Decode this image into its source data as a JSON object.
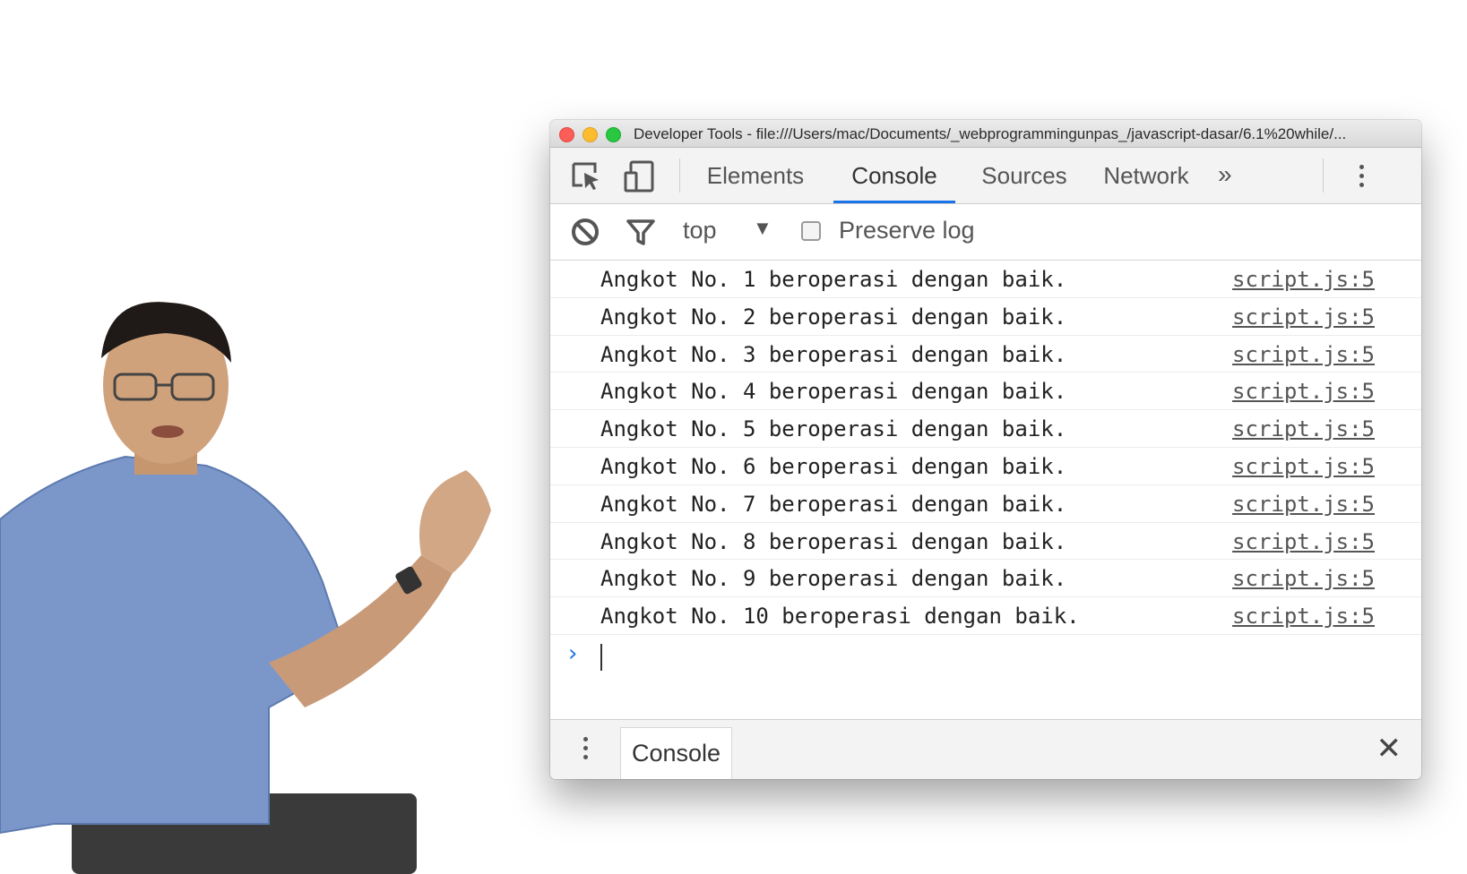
{
  "window": {
    "title": "Developer Tools - file:///Users/mac/Documents/_webprogrammingunpas_/javascript-dasar/6.1%20while/..."
  },
  "tabs": [
    {
      "label": "Elements"
    },
    {
      "label": "Console",
      "active": true
    },
    {
      "label": "Sources"
    },
    {
      "label": "Network"
    }
  ],
  "toolbar": {
    "more_tabs_label": "»",
    "inspect_icon": "inspect-element-icon",
    "device_icon": "device-toolbar-icon"
  },
  "filter": {
    "clear_icon": "clear-console-icon",
    "filter_icon": "filter-icon",
    "context": "top",
    "context_arrow": "▼",
    "preserve_log_label": "Preserve log",
    "preserve_log_checked": false
  },
  "console": {
    "messages": [
      {
        "text": "Angkot No. 1 beroperasi dengan baik.",
        "source": "script.js:5"
      },
      {
        "text": "Angkot No. 2 beroperasi dengan baik.",
        "source": "script.js:5"
      },
      {
        "text": "Angkot No. 3 beroperasi dengan baik.",
        "source": "script.js:5"
      },
      {
        "text": "Angkot No. 4 beroperasi dengan baik.",
        "source": "script.js:5"
      },
      {
        "text": "Angkot No. 5 beroperasi dengan baik.",
        "source": "script.js:5"
      },
      {
        "text": "Angkot No. 6 beroperasi dengan baik.",
        "source": "script.js:5"
      },
      {
        "text": "Angkot No. 7 beroperasi dengan baik.",
        "source": "script.js:5"
      },
      {
        "text": "Angkot No. 8 beroperasi dengan baik.",
        "source": "script.js:5"
      },
      {
        "text": "Angkot No. 9 beroperasi dengan baik.",
        "source": "script.js:5"
      },
      {
        "text": "Angkot No. 10 beroperasi dengan baik.",
        "source": "script.js:5"
      }
    ],
    "prompt_symbol": "›"
  },
  "drawer": {
    "tab_label": "Console",
    "close_symbol": "✕"
  },
  "colors": {
    "accent": "#1a73e8",
    "shirt": "#6f8fc4"
  }
}
